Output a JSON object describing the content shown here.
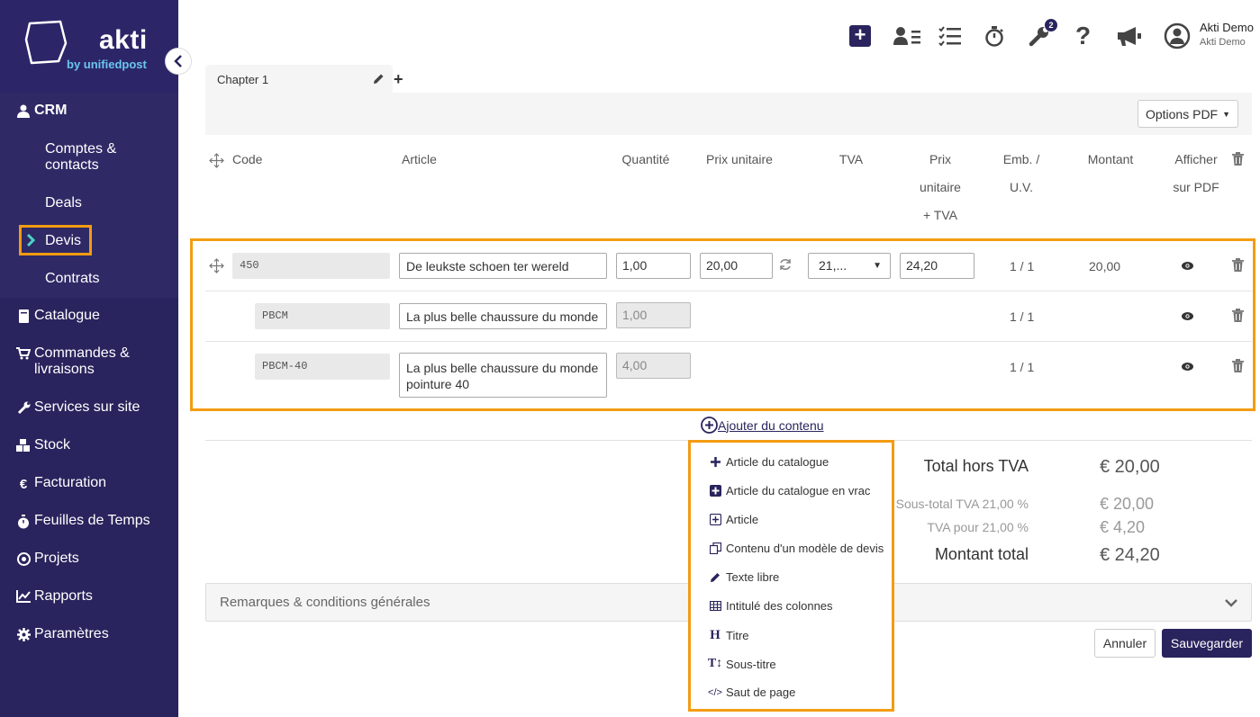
{
  "brand": {
    "name": "akti",
    "tagline": "by unifiedpost"
  },
  "sidebar": {
    "crm_label": "CRM",
    "crm_items": [
      {
        "label": "Comptes & contacts"
      },
      {
        "label": "Deals"
      },
      {
        "label": "Devis"
      },
      {
        "label": "Contrats"
      }
    ],
    "items": [
      {
        "label": "Catalogue",
        "icon": "book-icon"
      },
      {
        "label": "Commandes & livraisons",
        "icon": "cart-icon"
      },
      {
        "label": "Services sur site",
        "icon": "wrench-icon"
      },
      {
        "label": "Stock",
        "icon": "boxes-icon"
      },
      {
        "label": "Facturation",
        "icon": "euro-icon"
      },
      {
        "label": "Feuilles de Temps",
        "icon": "stopwatch-icon"
      },
      {
        "label": "Projets",
        "icon": "target-icon"
      },
      {
        "label": "Rapports",
        "icon": "chart-icon"
      },
      {
        "label": "Paramètres",
        "icon": "gear-icon"
      }
    ]
  },
  "topbar": {
    "notifications_badge": "2",
    "user_name": "Akti Demo",
    "user_company": "Akti Demo"
  },
  "chapter": {
    "tab_label": "Chapter 1",
    "options_pdf": "Options PDF"
  },
  "table": {
    "headers": {
      "code": "Code",
      "article": "Article",
      "quantite": "Quantité",
      "prix_unitaire": "Prix unitaire",
      "tva": "TVA",
      "prix_tva_1": "Prix",
      "prix_tva_2": "unitaire",
      "prix_tva_3": "+ TVA",
      "emb_1": "Emb. /",
      "emb_2": "U.V.",
      "montant": "Montant",
      "afficher_1": "Afficher",
      "afficher_2": "sur PDF"
    },
    "rows": [
      {
        "code": "450",
        "article": "De leukste schoen ter wereld",
        "quantite": "1,00",
        "prix_unitaire": "20,00",
        "tva": "21,...",
        "prix_tva": "24,20",
        "emb": "1 / 1",
        "montant": "20,00"
      },
      {
        "code": "PBCM",
        "article": "La plus belle chaussure du monde",
        "quantite": "1,00",
        "emb": "1 / 1"
      },
      {
        "code": "PBCM-40",
        "article_line1": "La plus belle chaussure du monde",
        "article_line2": "pointure 40",
        "quantite": "4,00",
        "emb": "1 / 1"
      }
    ]
  },
  "add_content": {
    "label": "Ajouter du contenu",
    "menu": [
      {
        "label": "Article du catalogue",
        "icon": "plus-icon"
      },
      {
        "label": "Article du catalogue en vrac",
        "icon": "plus-square-icon"
      },
      {
        "label": "Article",
        "icon": "plus-box-icon"
      },
      {
        "label": "Contenu d'un modèle de devis",
        "icon": "copy-icon"
      },
      {
        "label": "Texte libre",
        "icon": "pencil-icon"
      },
      {
        "label": "Intitulé des colonnes",
        "icon": "table-icon"
      },
      {
        "label": "Titre",
        "icon": "heading-icon"
      },
      {
        "label": "Sous-titre",
        "icon": "text-height-icon"
      },
      {
        "label": "Saut de page",
        "icon": "code-icon"
      }
    ]
  },
  "totals": {
    "total_ht_label": "Total hors TVA",
    "total_ht_value": "€ 20,00",
    "sous_total_label": "Sous-total  TVA 21,00 %",
    "sous_total_value": "€ 20,00",
    "tva_label": "TVA pour 21,00 %",
    "tva_value": "€ 4,20",
    "montant_total_label": "Montant total",
    "montant_total_value": "€ 24,20"
  },
  "remarks_label": "Remarques & conditions générales",
  "buttons": {
    "cancel": "Annuler",
    "save": "Sauvegarder"
  },
  "colors": {
    "sidebar": "#29245d",
    "accent": "#f39c12",
    "primary": "#29245d",
    "logo_sub": "#6bc6f0"
  }
}
